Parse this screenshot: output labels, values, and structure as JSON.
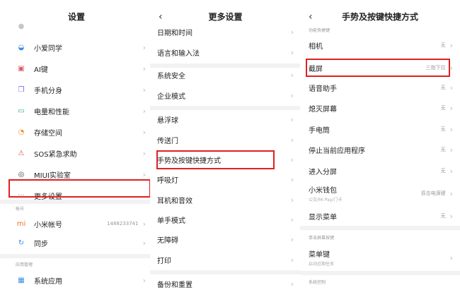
{
  "colors": {
    "accent_red": "#e02020"
  },
  "left": {
    "title": "设置",
    "items": [
      {
        "label": "小爱同学",
        "icon": "xiaoai-icon",
        "color": "#3a8ee6"
      },
      {
        "label": "AI键",
        "icon": "ai-key-icon",
        "color": "#e05a6a"
      },
      {
        "label": "手机分身",
        "icon": "dual-phone-icon",
        "color": "#7a6ae6"
      },
      {
        "label": "电量和性能",
        "icon": "battery-icon",
        "color": "#21b07a"
      },
      {
        "label": "存储空间",
        "icon": "storage-icon",
        "color": "#f08a24"
      },
      {
        "label": "SOS紧急求助",
        "icon": "sos-icon",
        "color": "#e04a3a"
      },
      {
        "label": "MIUI实验室",
        "icon": "lab-icon",
        "color": "#444"
      },
      {
        "label": "更多设置",
        "icon": "more-dots-icon",
        "color": "#888"
      }
    ],
    "section_account": "帐号",
    "account_items": [
      {
        "label": "小米帐号",
        "value": "1488233741",
        "icon": "mi-icon",
        "color": "#f36f21"
      },
      {
        "label": "同步",
        "icon": "sync-icon",
        "color": "#3a8ee6"
      }
    ],
    "section_apps": "应用管理",
    "app_items": [
      {
        "label": "系统应用",
        "icon": "apps-grid-icon",
        "color": "#3a8ee6"
      }
    ]
  },
  "middle": {
    "title": "更多设置",
    "back": "‹",
    "items": [
      "日期和时间",
      "语言和输入法",
      "系统安全",
      "企业模式",
      "悬浮球",
      "传送门",
      "手势及按键快捷方式",
      "呼吸灯",
      "耳机和音效",
      "单手模式",
      "无障碍",
      "打印",
      "备份和重置"
    ]
  },
  "right": {
    "title": "手势及按键快捷方式",
    "back": "‹",
    "section_shortcut": "功能快捷键",
    "items": [
      {
        "label": "相机",
        "value": "无"
      },
      {
        "label": "截屏",
        "value": "三指下拉"
      },
      {
        "label": "语音助手",
        "value": "无"
      },
      {
        "label": "熄灭屏幕",
        "value": "无"
      },
      {
        "label": "手电筒",
        "value": "无"
      },
      {
        "label": "停止当前应用程序",
        "value": "无"
      },
      {
        "label": "进入分屏",
        "value": "无"
      },
      {
        "label": "小米钱包",
        "value": "双击电源键",
        "sub": "公交/Mi Pay/门卡"
      },
      {
        "label": "显示菜单",
        "value": "无"
      }
    ],
    "section_single": "单击屏幕按键",
    "menu_key": {
      "label": "菜单键",
      "sub": "启动近期任务"
    },
    "section_system": "系统控制"
  }
}
